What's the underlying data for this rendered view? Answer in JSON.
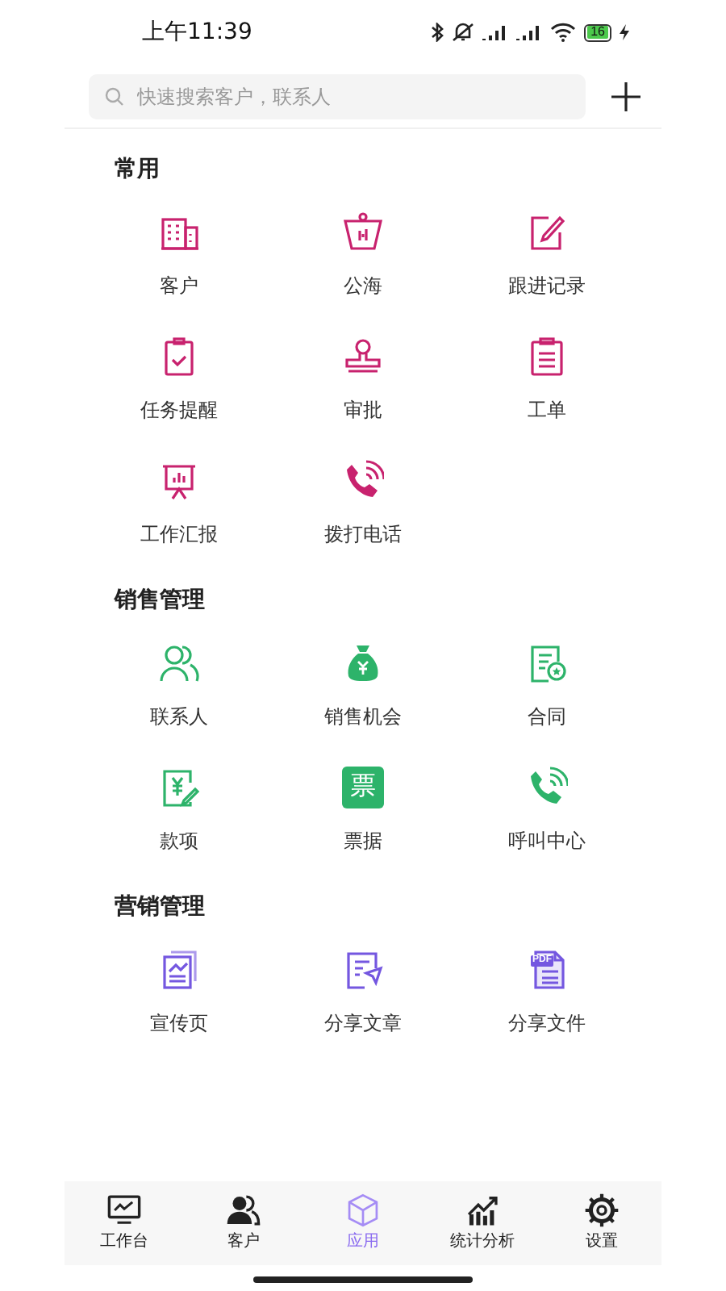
{
  "status_bar": {
    "time": "上午11:39",
    "battery": "16"
  },
  "search": {
    "placeholder": "快速搜索客户，联系人"
  },
  "sections": [
    {
      "title": "常用",
      "items": [
        {
          "label": "客户"
        },
        {
          "label": "公海"
        },
        {
          "label": "跟进记录"
        },
        {
          "label": "任务提醒"
        },
        {
          "label": "审批"
        },
        {
          "label": "工单"
        },
        {
          "label": "工作汇报"
        },
        {
          "label": "拨打电话"
        }
      ]
    },
    {
      "title": "销售管理",
      "items": [
        {
          "label": "联系人"
        },
        {
          "label": "销售机会"
        },
        {
          "label": "合同"
        },
        {
          "label": "款项"
        },
        {
          "label": "票据",
          "icon_text": "票"
        },
        {
          "label": "呼叫中心"
        }
      ]
    },
    {
      "title": "营销管理",
      "items": [
        {
          "label": "宣传页"
        },
        {
          "label": "分享文章"
        },
        {
          "label": "分享文件",
          "icon_text": "PDF"
        }
      ]
    }
  ],
  "tabs": [
    {
      "label": "工作台",
      "selected": false
    },
    {
      "label": "客户",
      "selected": false
    },
    {
      "label": "应用",
      "selected": true
    },
    {
      "label": "统计分析",
      "selected": false
    },
    {
      "label": "设置",
      "selected": false
    }
  ]
}
